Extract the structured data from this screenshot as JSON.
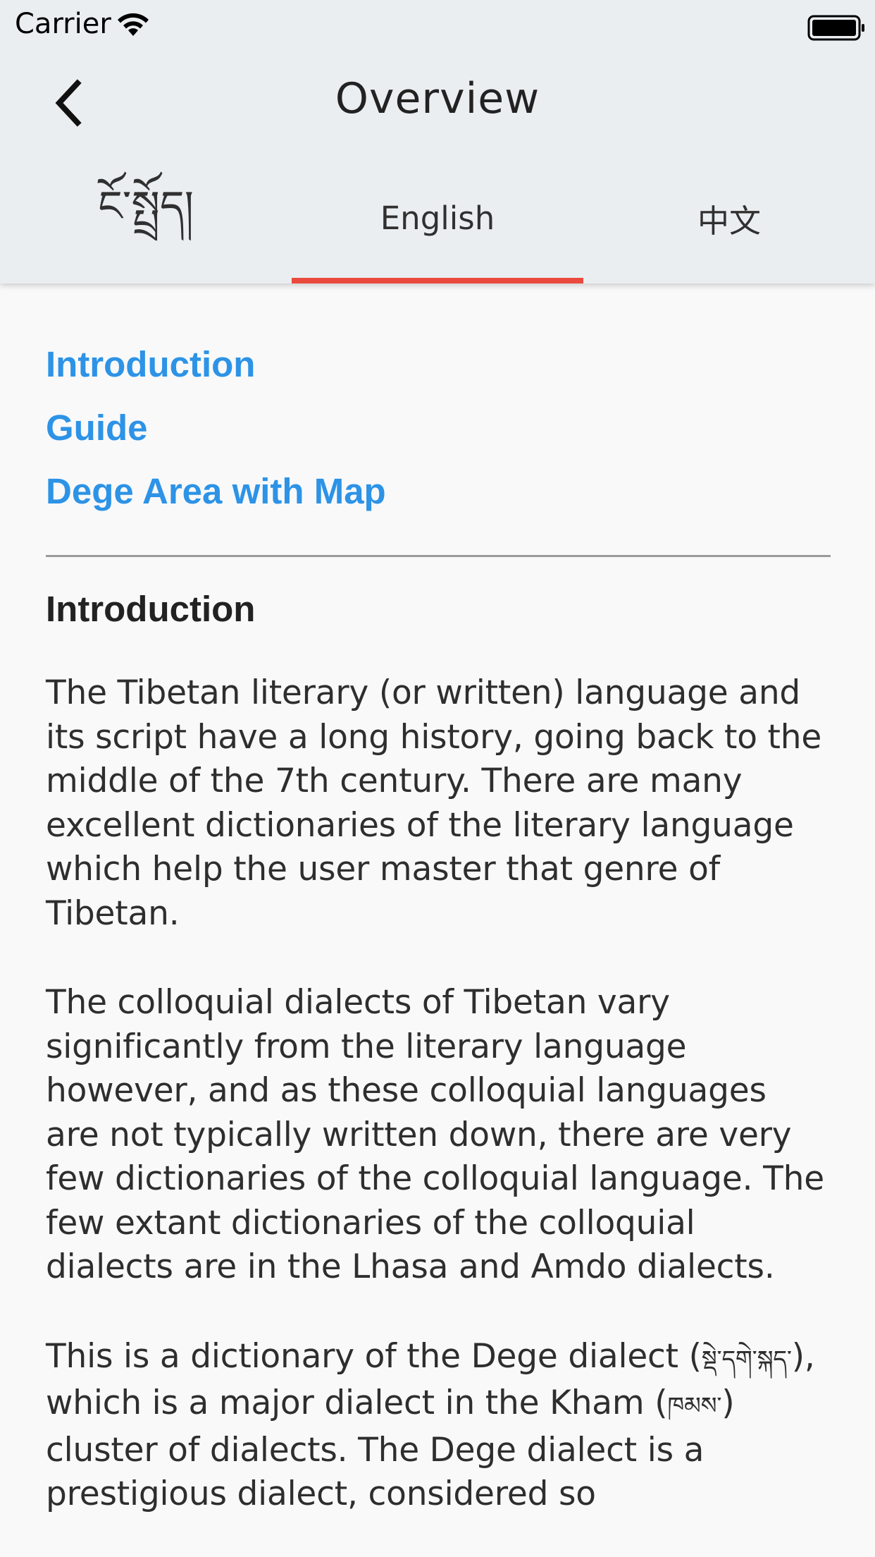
{
  "status_bar": {
    "carrier": "Carrier"
  },
  "nav": {
    "title": "Overview"
  },
  "tabs": [
    {
      "label": "ངོ་སྤྲོད།",
      "active": false
    },
    {
      "label": "English",
      "active": true
    },
    {
      "label": "中文",
      "active": false
    }
  ],
  "toc": [
    {
      "label": "Introduction"
    },
    {
      "label": "Guide"
    },
    {
      "label": "Dege Area with Map"
    }
  ],
  "section": {
    "heading": "Introduction",
    "paragraphs": [
      "The Tibetan literary (or written) language and its script have a long history, going back to the middle of the 7th century. There are many excellent dictionaries of the literary language which help the user master that genre of Tibetan.",
      "The colloquial dialects of Tibetan vary significantly from the literary language however, and as these colloquial languages are not typically written down, there are very few dictionaries of the colloquial language. The few extant dictionaries of the colloquial dialects are in the Lhasa and Amdo dialects."
    ],
    "para3": {
      "t1": "This is a dictionary of the Dege dialect (",
      "tib1": "སྡེ་དགེ་སྐད་",
      "t2": "), which is a major dialect in the Kham (",
      "tib2": "ཁམས་",
      "t3": ") cluster of dialects. The Dege dialect is a prestigious dialect, considered so"
    }
  },
  "colors": {
    "accent": "#2d93e6",
    "tab_indicator": "#ea4a3d",
    "header_bg": "#ebeef1",
    "page_bg": "#f9f9fa"
  },
  "icons": [
    "wifi-icon",
    "battery-icon",
    "back-arrow-icon"
  ]
}
